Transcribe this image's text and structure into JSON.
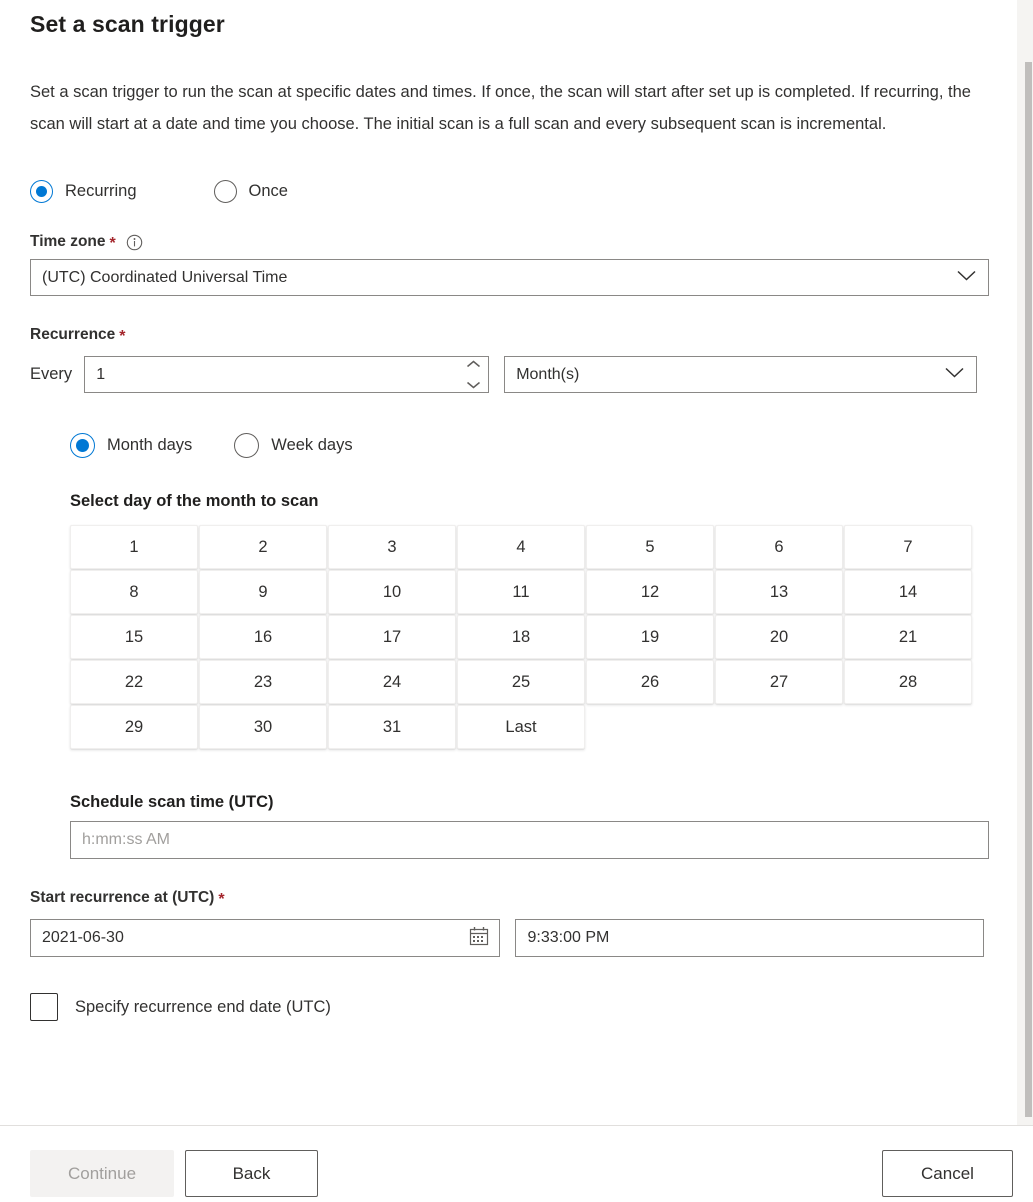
{
  "panel": {
    "title": "Set a scan trigger",
    "description": "Set a scan trigger to run the scan at specific dates and times. If once, the scan will start after set up is completed. If recurring, the scan will start at a date and time you choose. The initial scan is a full scan and every subsequent scan is incremental."
  },
  "trigger_type": {
    "options": [
      {
        "label": "Recurring",
        "selected": true
      },
      {
        "label": "Once",
        "selected": false
      }
    ]
  },
  "time_zone": {
    "label": "Time zone",
    "required_marker": "*",
    "info_icon": "info-circle-icon",
    "value": "(UTC) Coordinated Universal Time",
    "chevron_icon": "chevron-down-icon"
  },
  "recurrence": {
    "label": "Recurrence",
    "required_marker": "*",
    "every_label": "Every",
    "interval_value": "1",
    "spinner_up_icon": "chevron-up-icon",
    "spinner_down_icon": "chevron-down-icon",
    "unit_value": "Month(s)",
    "unit_chevron_icon": "chevron-down-icon",
    "mode_options": [
      {
        "label": "Month days",
        "selected": true
      },
      {
        "label": "Week days",
        "selected": false
      }
    ]
  },
  "day_grid": {
    "title": "Select day of the month to scan",
    "days": [
      "1",
      "2",
      "3",
      "4",
      "5",
      "6",
      "7",
      "8",
      "9",
      "10",
      "11",
      "12",
      "13",
      "14",
      "15",
      "16",
      "17",
      "18",
      "19",
      "20",
      "21",
      "22",
      "23",
      "24",
      "25",
      "26",
      "27",
      "28",
      "29",
      "30",
      "31",
      "Last"
    ]
  },
  "schedule_time": {
    "label": "Schedule scan time (UTC)",
    "placeholder": "h:mm:ss AM",
    "value": ""
  },
  "start_recurrence": {
    "label": "Start recurrence at (UTC)",
    "required_marker": "*",
    "date_value": "2021-06-30",
    "calendar_icon": "calendar-icon",
    "time_value": "9:33:00 PM"
  },
  "end_date": {
    "checkbox_label": "Specify recurrence end date (UTC)",
    "checked": false
  },
  "footer": {
    "continue_label": "Continue",
    "continue_disabled": true,
    "back_label": "Back",
    "cancel_label": "Cancel"
  },
  "colors": {
    "accent": "#0078d4",
    "required_star": "#a4262c",
    "text": "#323130",
    "border": "#8a8886",
    "disabled_bg": "#f3f2f1",
    "disabled_text": "#a19f9d"
  }
}
